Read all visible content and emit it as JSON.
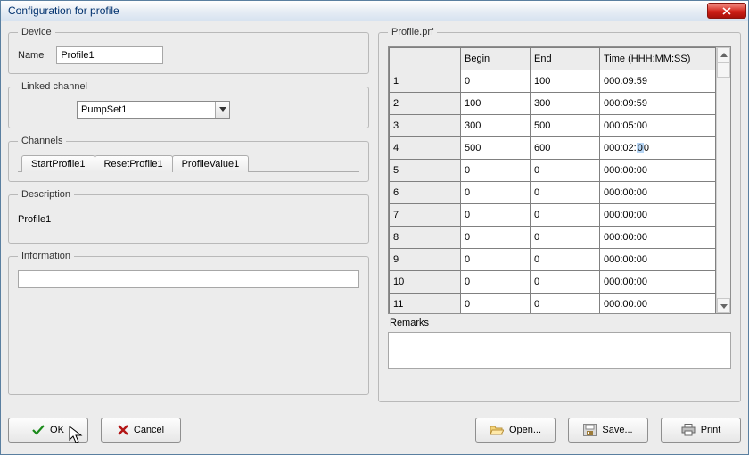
{
  "title": "Configuration for profile",
  "left": {
    "device": {
      "legend": "Device",
      "name_label": "Name",
      "name_value": "Profile1"
    },
    "linked": {
      "legend": "Linked channel",
      "value": "PumpSet1"
    },
    "channels": {
      "legend": "Channels",
      "tabs": [
        "StartProfile1",
        "ResetProfile1",
        "ProfileValue1"
      ]
    },
    "description": {
      "legend": "Description",
      "text": "Profile1"
    },
    "information": {
      "legend": "Information",
      "value": ""
    }
  },
  "right": {
    "legend": "Profile.prf",
    "columns": {
      "begin": "Begin",
      "end": "End",
      "time": "Time (HHH:MM:SS)"
    },
    "rows": [
      {
        "n": "1",
        "begin": "0",
        "end": "100",
        "time": "000:09:59"
      },
      {
        "n": "2",
        "begin": "100",
        "end": "300",
        "time": "000:09:59"
      },
      {
        "n": "3",
        "begin": "300",
        "end": "500",
        "time": "000:05:00"
      },
      {
        "n": "4",
        "begin": "500",
        "end": "600",
        "time": "000:02:00",
        "edit_sel": "0"
      },
      {
        "n": "5",
        "begin": "0",
        "end": "0",
        "time": "000:00:00"
      },
      {
        "n": "6",
        "begin": "0",
        "end": "0",
        "time": "000:00:00"
      },
      {
        "n": "7",
        "begin": "0",
        "end": "0",
        "time": "000:00:00"
      },
      {
        "n": "8",
        "begin": "0",
        "end": "0",
        "time": "000:00:00"
      },
      {
        "n": "9",
        "begin": "0",
        "end": "0",
        "time": "000:00:00"
      },
      {
        "n": "10",
        "begin": "0",
        "end": "0",
        "time": "000:00:00"
      },
      {
        "n": "11",
        "begin": "0",
        "end": "0",
        "time": "000:00:00"
      }
    ],
    "remarks_label": "Remarks",
    "remarks_value": ""
  },
  "buttons": {
    "ok": "OK",
    "cancel": "Cancel",
    "open": "Open...",
    "save": "Save...",
    "print": "Print"
  }
}
